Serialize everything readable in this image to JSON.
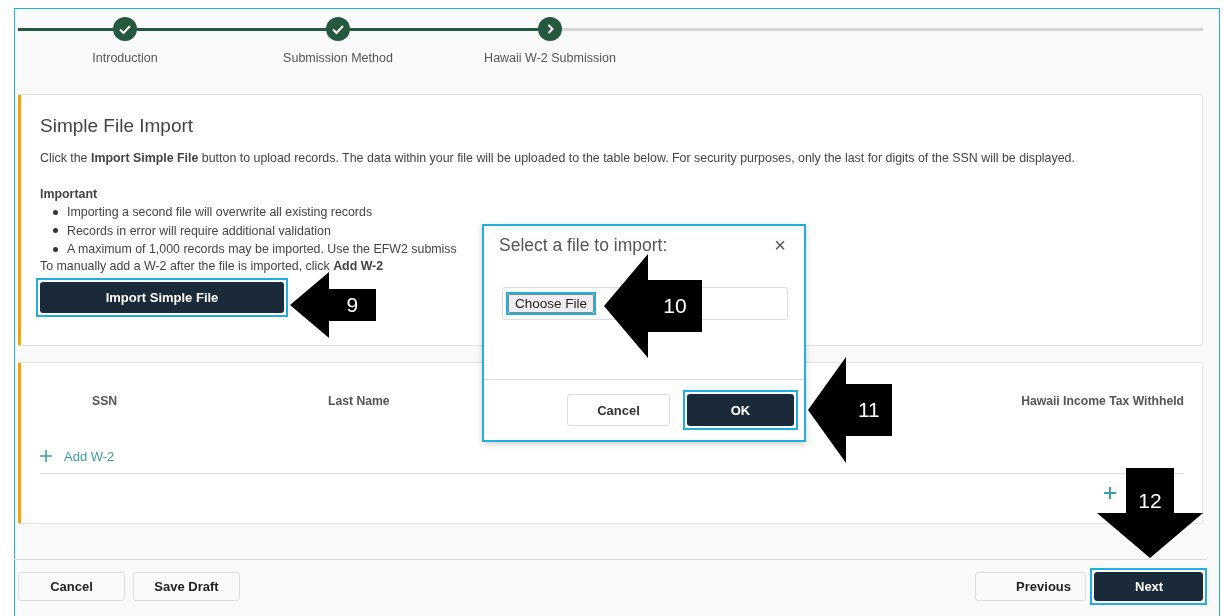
{
  "steps": [
    {
      "label": "Introduction",
      "completed": true
    },
    {
      "label": "Submission Method",
      "completed": true
    },
    {
      "label": "Hawaii W-2 Submission",
      "completed": false
    }
  ],
  "import_panel": {
    "title": "Simple File Import",
    "description": "Click the **Import Simple File** button to upload records. The data within your file will be uploaded to the table below. For security purposes, only the last for digits of the SSN will be displayed.",
    "important_heading": "Important",
    "bullets": [
      "Importing a second file will overwrite all existing records",
      "Records in error will require additional validation",
      "A maximum of 1,000 records may be imported. Use the EFW2 submiss"
    ],
    "manual_note": "To manually add a W-2 after the file is imported, click **Add W-2**",
    "button": {
      "label": "Import Simple File",
      "highlighted": true
    }
  },
  "table": {
    "columns": [
      "SSN",
      "Last Name",
      "Hawaii Income Tax Withheld"
    ],
    "add_link": "Add W-2"
  },
  "footer": {
    "buttons": [
      {
        "label": "Cancel",
        "kind": "plain",
        "highlighted": false
      },
      {
        "label": "Save Draft",
        "kind": "plain",
        "highlighted": false
      },
      {
        "label": "Previous",
        "kind": "prev",
        "highlighted": false
      },
      {
        "label": "Next",
        "kind": "next",
        "highlighted": true
      }
    ]
  },
  "dialog": {
    "title": "Select a file to import:",
    "close": "×",
    "file_button": {
      "label": "Choose File",
      "highlighted": true
    },
    "buttons": [
      {
        "label": "Cancel",
        "kind": "plain",
        "highlighted": false
      },
      {
        "label": "OK",
        "kind": "primary",
        "highlighted": true
      }
    ]
  },
  "callouts": [
    {
      "number": "9",
      "kind": "left"
    },
    {
      "number": "10",
      "kind": "left"
    },
    {
      "number": "11",
      "kind": "left"
    },
    {
      "number": "12",
      "kind": "down"
    }
  ]
}
